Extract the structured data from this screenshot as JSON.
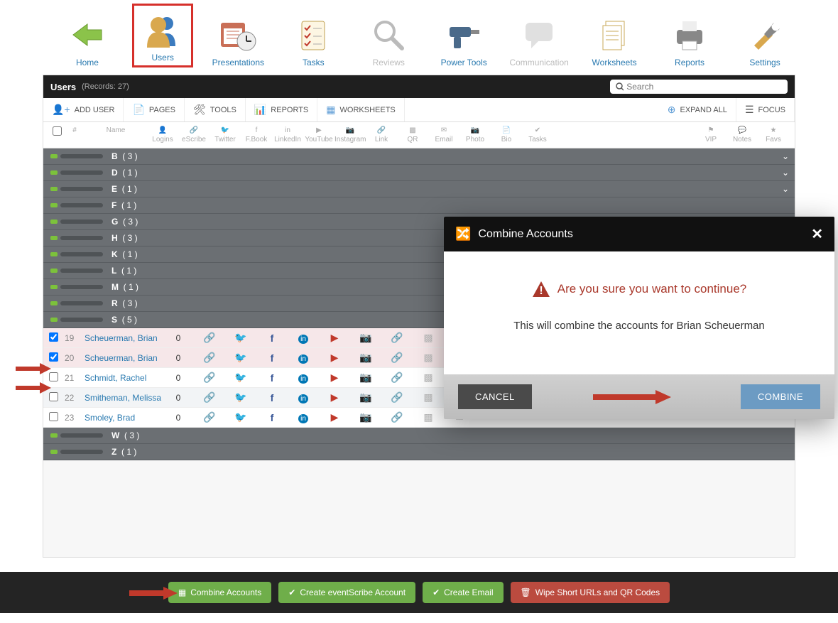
{
  "nav": {
    "items": [
      {
        "label": "Home"
      },
      {
        "label": "Users"
      },
      {
        "label": "Presentations"
      },
      {
        "label": "Tasks"
      },
      {
        "label": "Reviews"
      },
      {
        "label": "Power Tools"
      },
      {
        "label": "Communication"
      },
      {
        "label": "Worksheets"
      },
      {
        "label": "Reports"
      },
      {
        "label": "Settings"
      }
    ]
  },
  "titlebar": {
    "title": "Users",
    "records": "(Records: 27)",
    "search_placeholder": "Search"
  },
  "toolbar": {
    "add_user": "ADD USER",
    "pages": "PAGES",
    "tools": "TOOLS",
    "reports": "REPORTS",
    "worksheets": "WORKSHEETS",
    "expand": "EXPAND ALL",
    "focus": "FOCUS"
  },
  "cols": {
    "num": "#",
    "name": "Name",
    "logins": "Logins",
    "escribe": "eScribe",
    "twitter": "Twitter",
    "fbook": "F.Book",
    "linkedin": "LinkedIn",
    "youtube": "YouTube",
    "instagram": "Instagram",
    "link": "Link",
    "qr": "QR",
    "email": "Email",
    "photo": "Photo",
    "bio": "Bio",
    "tasks": "Tasks",
    "vip": "VIP",
    "notes": "Notes",
    "favs": "Favs"
  },
  "groups_top": [
    {
      "l": "B",
      "c": "( 3 )"
    },
    {
      "l": "D",
      "c": "( 1 )"
    },
    {
      "l": "E",
      "c": "( 1 )"
    },
    {
      "l": "F",
      "c": "( 1 )"
    },
    {
      "l": "G",
      "c": "( 3 )"
    },
    {
      "l": "H",
      "c": "( 3 )"
    },
    {
      "l": "K",
      "c": "( 1 )"
    },
    {
      "l": "L",
      "c": "( 1 )"
    },
    {
      "l": "M",
      "c": "( 1 )"
    },
    {
      "l": "R",
      "c": "( 3 )"
    },
    {
      "l": "S",
      "c": "( 5 )"
    }
  ],
  "groups_bottom": [
    {
      "l": "W",
      "c": "( 3 )"
    },
    {
      "l": "Z",
      "c": "( 1 )"
    }
  ],
  "rows": [
    {
      "num": "19",
      "name": "Scheuerman, Brian",
      "logins": "0",
      "checked": true,
      "sel": true
    },
    {
      "num": "20",
      "name": "Scheuerman, Brian",
      "logins": "0",
      "checked": true,
      "sel": true
    },
    {
      "num": "21",
      "name": "Schmidt, Rachel",
      "logins": "0",
      "checked": false,
      "sel": false
    },
    {
      "num": "22",
      "name": "Smitheman, Melissa",
      "logins": "0",
      "checked": false,
      "sel": false
    },
    {
      "num": "23",
      "name": "Smoley, Brad",
      "logins": "0",
      "checked": false,
      "sel": false
    }
  ],
  "actions": {
    "combine": "Combine Accounts",
    "create_es": "Create eventScribe Account",
    "create_email": "Create Email",
    "wipe": "Wipe Short URLs and QR Codes"
  },
  "modal": {
    "title": "Combine Accounts",
    "warn": "Are you sure you want to continue?",
    "msg": "This will combine the accounts for Brian Scheuerman",
    "cancel": "CANCEL",
    "combine": "COMBINE"
  }
}
